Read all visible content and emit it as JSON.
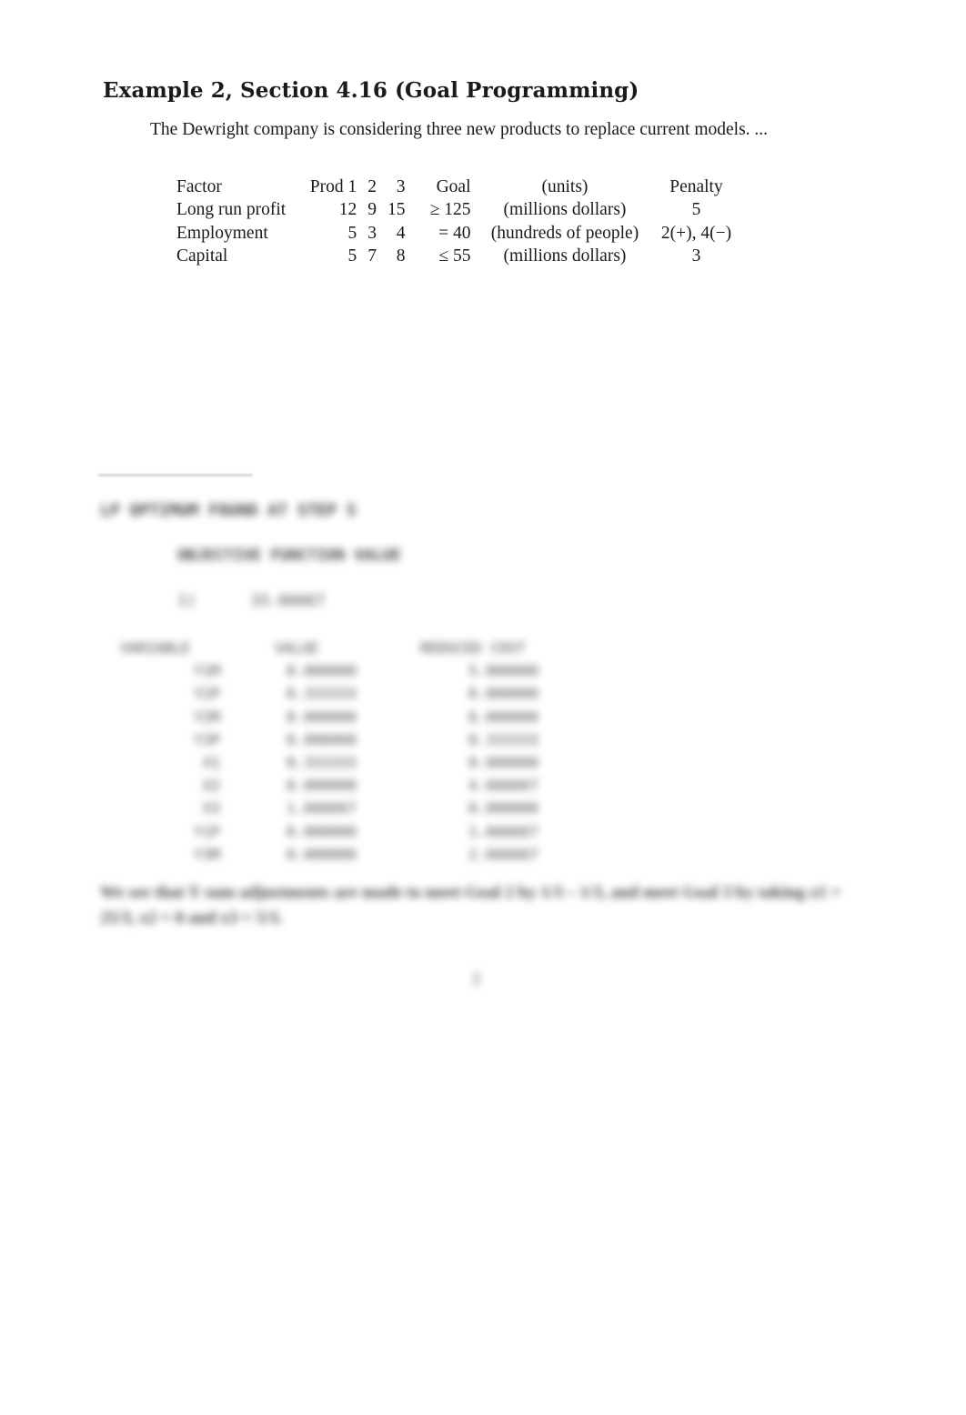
{
  "heading": "Example 2, Section 4.16 (Goal Programming)",
  "intro": "The Dewright company is considering three new products to replace current models. ...",
  "goal_table": {
    "headers": [
      "Factor",
      "Prod 1",
      "2",
      "3",
      "Goal",
      "(units)",
      "Penalty"
    ],
    "rows": [
      {
        "factor": "Long run profit",
        "p1": "12",
        "p2": "9",
        "p3": "15",
        "goal": "≥ 125",
        "units": "(millions dollars)",
        "penalty": "5"
      },
      {
        "factor": "Employment",
        "p1": "5",
        "p2": "3",
        "p3": "4",
        "goal": "= 40",
        "units": "(hundreds of people)",
        "penalty": "2(+), 4(−)"
      },
      {
        "factor": "Capital",
        "p1": "5",
        "p2": "7",
        "p3": "8",
        "goal": "≤ 55",
        "units": "(millions dollars)",
        "penalty": "3"
      }
    ]
  },
  "obscured": {
    "lp_header": "LP OPTIMUM FOUND AT STEP 5",
    "objective_header": "OBJECTIVE FUNCTION VALUE",
    "objective_row": {
      "label": "1)",
      "value": "33.66667"
    },
    "columns": [
      "VARIABLE",
      "VALUE",
      "REDUCED COST"
    ],
    "rows": [
      {
        "var": "Y1M",
        "value": "0.000000",
        "cost": "5.000000"
      },
      {
        "var": "Y2P",
        "value": "0.333333",
        "cost": "0.000000"
      },
      {
        "var": "Y2M",
        "value": "0.000000",
        "cost": "6.000000"
      },
      {
        "var": "Y3P",
        "value": "0.000000",
        "cost": "0.333333"
      },
      {
        "var": "X1",
        "value": "8.333333",
        "cost": "0.000000"
      },
      {
        "var": "X2",
        "value": "0.000000",
        "cost": "4.666667"
      },
      {
        "var": "X3",
        "value": "1.666667",
        "cost": "0.000000"
      },
      {
        "var": "Y1P",
        "value": "0.000000",
        "cost": "1.666667"
      },
      {
        "var": "Y3M",
        "value": "0.000000",
        "cost": "2.666667"
      }
    ],
    "note": "We see that Y sum adjustments are made to meet Goal 2 by 1/3 – 1/3, and meet Goal 3 by taking   x1 = 25/3,  x2 = 0 and  x3 = 5/3.",
    "page_number": "2"
  }
}
